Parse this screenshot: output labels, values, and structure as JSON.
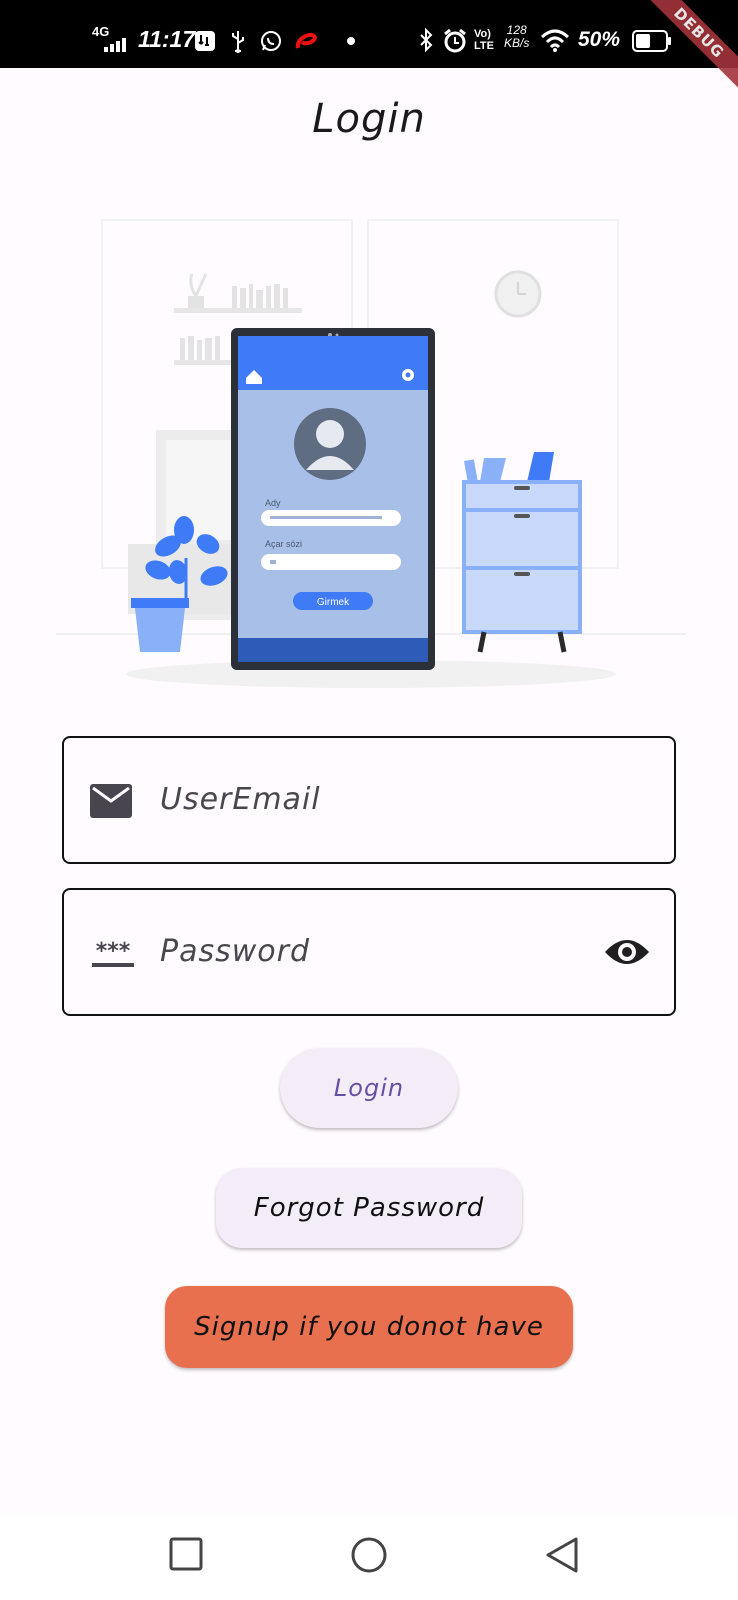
{
  "status_bar": {
    "network": "4G",
    "time": "11:17",
    "volte_top": "Vo)",
    "volte_bottom": "LTE",
    "speed_value": "128",
    "speed_unit": "KB/s",
    "battery_percent": "50%",
    "icons": [
      "signal-icon",
      "usb-debug-icon",
      "usb-icon",
      "whatsapp-icon",
      "airtel-icon",
      "dot-icon",
      "bluetooth-icon",
      "alarm-icon",
      "wifi-icon",
      "battery-icon"
    ]
  },
  "debug_banner": "DEBUG",
  "page": {
    "title": "Login"
  },
  "illustration": {
    "field_label_1": "Ady",
    "field_label_2": "Açar sözi",
    "button_label": "Girmek"
  },
  "form": {
    "email_placeholder": "UserEmail",
    "password_placeholder": "Password",
    "password_mask_icon": "***"
  },
  "buttons": {
    "login": "Login",
    "forgot": "Forgot Password",
    "signup": "Signup if you donot have"
  },
  "nav": {
    "icons": [
      "recents-square-icon",
      "home-circle-icon",
      "back-triangle-icon"
    ]
  },
  "colors": {
    "primary": "#6750a4",
    "accent_illustration": "#3f7bf6",
    "signup": "#e8704f",
    "background": "#fffbfe"
  }
}
